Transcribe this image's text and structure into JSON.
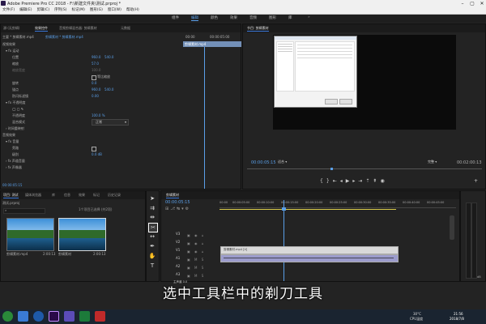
{
  "window": {
    "title": "Adobe Premiere Pro CC 2018 - F:\\新建文件夹\\测试.prproj *"
  },
  "menubar": {
    "items": [
      "文件(F)",
      "编辑(E)",
      "剪辑(C)",
      "序列(S)",
      "标记(M)",
      "图形(G)",
      "窗口(W)",
      "帮助(H)"
    ]
  },
  "workspace": {
    "tabs": [
      "组件",
      "编辑",
      "颜色",
      "效果",
      "音频",
      "图形",
      "库"
    ],
    "active_index": 1
  },
  "effect_controls": {
    "tabs": [
      "源:(无剪辑)",
      "效果控件",
      "音频剪辑混合器: 剪辑素材",
      "元数据"
    ],
    "clip_label": "主要 * 剪辑素材.mp4",
    "seq_label": "剪辑素材 * 剪辑素材.mp4",
    "timecodes": {
      "start": "00:00",
      "mid": "00:00:05:00"
    },
    "section_video": "视频效果",
    "motion": "运动",
    "position": {
      "label": "位置",
      "x": "960.0",
      "y": "540.0"
    },
    "scale": {
      "label": "缩放",
      "value": "57.0"
    },
    "scale_width": {
      "label": "缩放宽度",
      "value": "100.0"
    },
    "uniform": "等比缩放",
    "rotation": {
      "label": "旋转",
      "value": "0.0"
    },
    "anchor": {
      "label": "锚点",
      "x": "960.0",
      "y": "540.0"
    },
    "flicker": {
      "label": "防闪烁滤镜",
      "value": "0.00"
    },
    "opacity": "不透明度",
    "opacity_value": {
      "label": "不透明度",
      "value": "100.0 %"
    },
    "blend": {
      "label": "混合模式",
      "value": "正常"
    },
    "time_remap": "时间重映射",
    "section_audio": "音频效果",
    "volume": "音量",
    "bypass": "旁路",
    "level": {
      "label": "级别",
      "value": "0.0 dB"
    },
    "channel_volume": "声道音量",
    "panner": "声像器",
    "clip_name": "剪辑素材.mp4",
    "current_time": "00:00:05:15"
  },
  "program_monitor": {
    "tab": "节目: 剪辑素材",
    "timecode": "00:00:05:15",
    "fit": "适合",
    "quality": "完整",
    "duration": "00:02:00:13"
  },
  "project": {
    "tabs": [
      "项目: 测试",
      "媒体浏览器",
      "库",
      "信息",
      "效果",
      "标记",
      "历史记录"
    ],
    "path": "测试.prproj",
    "selection": "1个项目已选择 (共2项)",
    "items": [
      {
        "name": "剪辑素材.mp4",
        "duration": "2:00:13"
      },
      {
        "name": "剪辑素材",
        "duration": "2:00:13"
      }
    ]
  },
  "timeline": {
    "tab": "剪辑素材",
    "timecode": "00:00:05:15",
    "ruler": [
      "00:00",
      "00:00:05:00",
      "00:00:10:00",
      "00:00:15:00",
      "00:00:20:00",
      "00:00:25:00",
      "00:00:30:00",
      "00:00:35:00",
      "00:00:40:00",
      "00:00:45:00"
    ],
    "video_tracks": [
      "V3",
      "V2",
      "V1"
    ],
    "audio_tracks": [
      "A1",
      "A2",
      "A3"
    ],
    "master": {
      "label": "主声道",
      "value": "0.0"
    },
    "clip_label": "剪辑素材.mp4 [V]",
    "meter_labels": [
      "dB"
    ]
  },
  "caption": "选中工具栏中的剃刀工具",
  "taskbar": {
    "weather": "30°C",
    "weather_sub": "CPU温度",
    "time": "21:56",
    "date": "2018/7/8"
  },
  "colors": {
    "accent": "#5a9fe8",
    "playhead": "#5a9fe8",
    "clip_video": "#9c9ccc",
    "track_yellow": "#d8c94a"
  }
}
